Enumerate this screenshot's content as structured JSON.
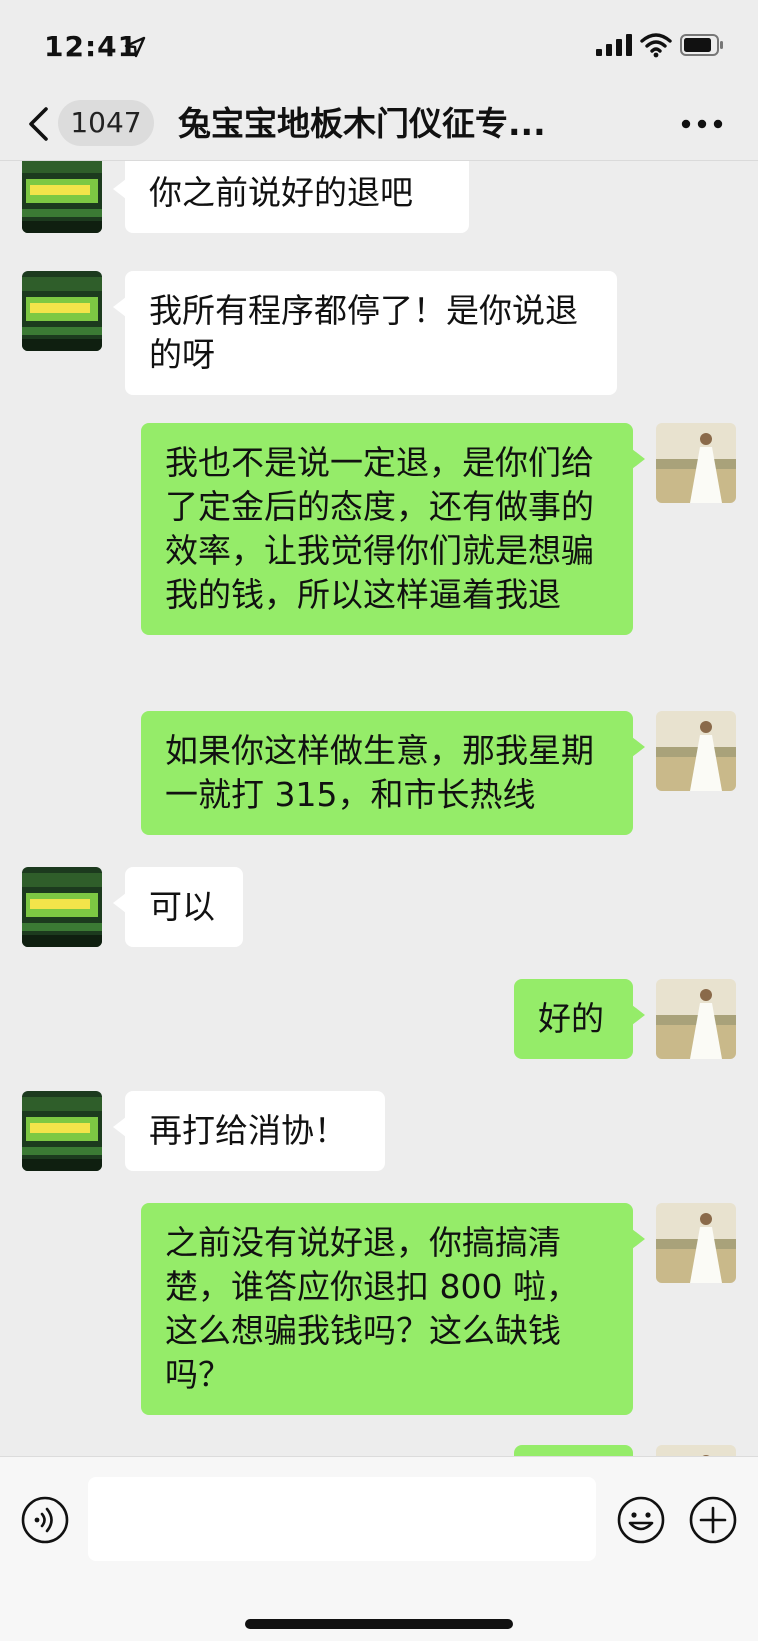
{
  "status_bar": {
    "time": "12:41"
  },
  "nav": {
    "unread_count": "1047",
    "title": "兔宝宝地板木门仪征专..."
  },
  "messages": [
    {
      "side": "left",
      "text": "你之前说好的退吧"
    },
    {
      "side": "left",
      "text": "我所有程序都停了！是你说退的呀"
    },
    {
      "side": "right",
      "text": "我也不是说一定退，是你们给了定金后的态度，还有做事的效率，让我觉得你们就是想骗我的钱，所以这样逼着我退"
    },
    {
      "side": "right",
      "text": "如果你这样做生意，那我星期一就打 315，和市长热线"
    },
    {
      "side": "left",
      "text": "可以"
    },
    {
      "side": "right",
      "text": "好的"
    },
    {
      "side": "left",
      "text": "再打给消协！"
    },
    {
      "side": "right",
      "text": "之前没有说好退，你搞搞清楚，谁答应你退扣 800 啦，这么想骗我钱吗？这么缺钱吗？"
    }
  ],
  "icons": {
    "back": "chevron-left-icon",
    "more": "more-dots-icon",
    "voice": "voice-icon",
    "emoji": "emoji-icon",
    "plus": "plus-icon"
  },
  "colors": {
    "sent_bubble": "#95ec69",
    "received_bubble": "#ffffff",
    "background": "#ededed"
  }
}
